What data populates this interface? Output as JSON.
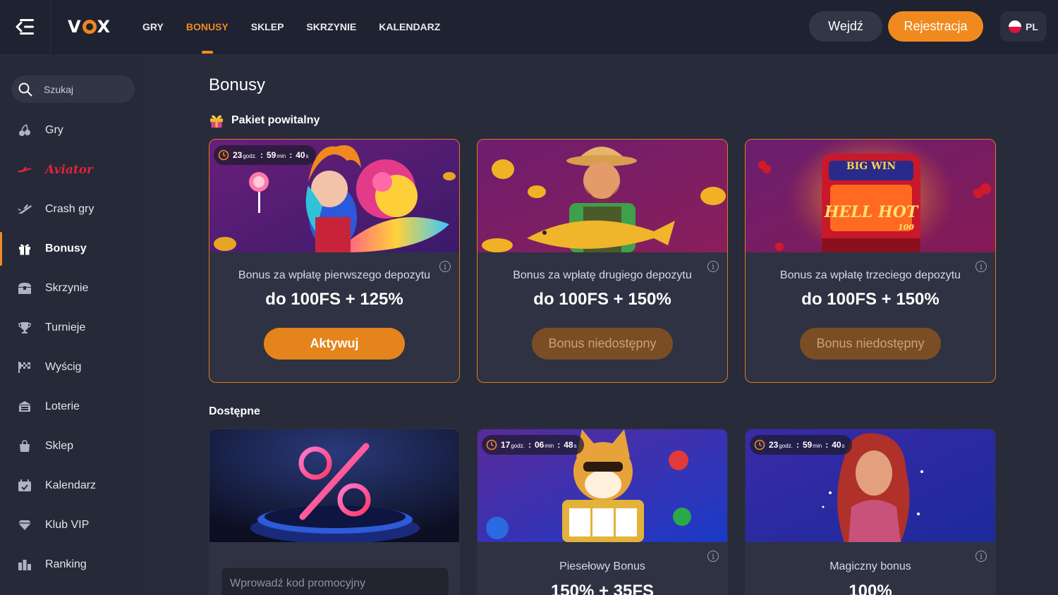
{
  "header": {
    "brand": "VOX",
    "nav": [
      {
        "label": "GRY",
        "active": false
      },
      {
        "label": "BONUSY",
        "active": true
      },
      {
        "label": "SKLEP",
        "active": false
      },
      {
        "label": "SKRZYNIE",
        "active": false
      },
      {
        "label": "KALENDARZ",
        "active": false
      }
    ],
    "login_label": "Wejdź",
    "register_label": "Rejestracja",
    "language": "PL",
    "accent_color": "#f08a24"
  },
  "sidebar": {
    "search_placeholder": "Szukaj",
    "items": [
      {
        "label": "Gry",
        "icon": "cherry-icon"
      },
      {
        "label": "Aviator",
        "icon": "plane-icon"
      },
      {
        "label": "Crash gry",
        "icon": "jet-icon"
      },
      {
        "label": "Bonusy",
        "icon": "gift-icon",
        "active": true
      },
      {
        "label": "Skrzynie",
        "icon": "chest-icon"
      },
      {
        "label": "Turnieje",
        "icon": "trophy-icon"
      },
      {
        "label": "Wyścig",
        "icon": "race-flag-icon"
      },
      {
        "label": "Loterie",
        "icon": "lottery-icon"
      },
      {
        "label": "Sklep",
        "icon": "shopping-bag-icon"
      },
      {
        "label": "Kalendarz",
        "icon": "calendar-icon"
      },
      {
        "label": "Klub VIP",
        "icon": "diamond-icon"
      },
      {
        "label": "Ranking",
        "icon": "ranking-icon"
      }
    ]
  },
  "main": {
    "title": "Bonusy",
    "welcome_section": "Pakiet powitalny",
    "available_section": "Dostępne",
    "welcome_cards": [
      {
        "timer": {
          "h": "23",
          "m": "59",
          "s": "40"
        },
        "subtitle": "Bonus za wpłatę pierwszego depozytu",
        "value": "do 100FS + 125%",
        "button": "Aktywuj",
        "enabled": true
      },
      {
        "subtitle": "Bonus za wpłatę drugiego depozytu",
        "value": "do 100FS + 150%",
        "button": "Bonus niedostępny",
        "enabled": false
      },
      {
        "subtitle": "Bonus za wpłatę trzeciego depozytu",
        "value": "do 100FS + 150%",
        "button": "Bonus niedostępny",
        "enabled": false,
        "banner_text": "BIG WIN",
        "banner_logo": "HELL HOT",
        "banner_logo_sub": "100"
      }
    ],
    "available_cards": [
      {
        "promo_placeholder": "Wprowadź kod promocyjny"
      },
      {
        "timer": {
          "h": "17",
          "m": "06",
          "s": "48"
        },
        "subtitle": "Piesełowy Bonus",
        "value": "150% + 35FS"
      },
      {
        "timer": {
          "h": "23",
          "m": "59",
          "s": "40"
        },
        "subtitle": "Magiczny bonus",
        "value": "100%"
      }
    ],
    "timer_units": {
      "h": "godz.",
      "m": "min",
      "s": "s"
    }
  }
}
